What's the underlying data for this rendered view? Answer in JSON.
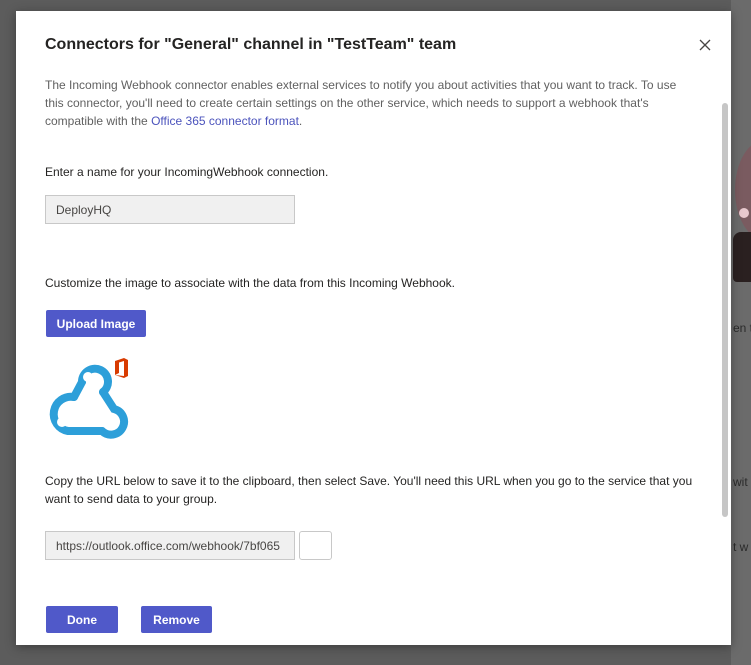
{
  "dialog": {
    "title": "Connectors for \"General\" channel in \"TestTeam\" team",
    "close_icon": "close-icon",
    "intro_text": "The Incoming Webhook connector enables external services to notify you about activities that you want to track. To use this connector, you'll need to create certain settings on the other service, which needs to support a webhook that's compatible with the ",
    "intro_link": "Office 365 connector format",
    "intro_end": ".",
    "name_label": "Enter a name for your IncomingWebhook connection.",
    "name_value": "DeployHQ",
    "image_label": "Customize the image to associate with the data from this Incoming Webhook.",
    "upload_button": "Upload Image",
    "logo_icon": "webhook-office-logo",
    "url_label": "Copy the URL below to save it to the clipboard, then select Save. You'll need this URL when you go to the service that you want to send data to your group.",
    "url_value": "https://outlook.office.com/webhook/7bf065",
    "copy_icon": "copy-icon",
    "done_button": "Done",
    "remove_button": "Remove"
  },
  "background": {
    "snippet_1": "en t",
    "snippet_2": "wit",
    "snippet_3": "t w"
  },
  "colors": {
    "accent": "#5059c9",
    "link": "#4b53bc",
    "overlay": "#5c5c5c",
    "logo_blue": "#2d9fd9",
    "logo_orange": "#d83b01"
  }
}
